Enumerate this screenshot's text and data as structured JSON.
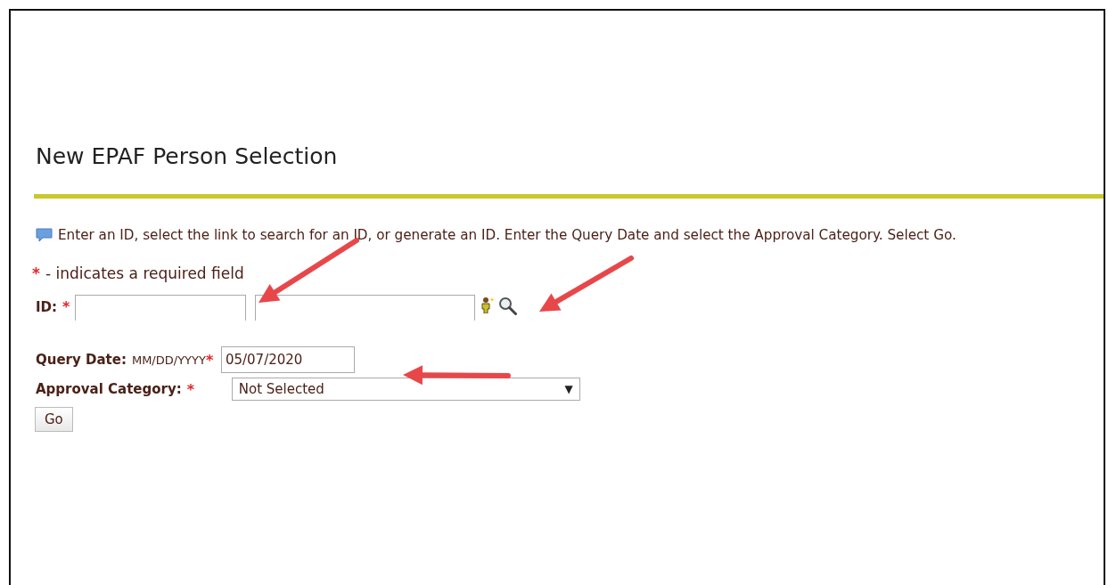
{
  "page": {
    "title": "New EPAF Person Selection",
    "instruction": "Enter an ID, select the link to search for an ID, or generate an ID. Enter the Query Date and select the Approval Category. Select Go.",
    "required_note": {
      "mark": "*",
      "text": "- indicates a required field"
    },
    "id_field": {
      "label": "ID:",
      "required_mark": "*"
    },
    "query_date": {
      "label": "Query Date:",
      "format_hint": "MM/DD/YYYY",
      "required_mark": "*",
      "value": "05/07/2020"
    },
    "approval_category": {
      "label": "Approval Category:",
      "required_mark": "*",
      "value": "Not Selected",
      "caret": "▼"
    },
    "go_button": "Go"
  },
  "annotations": [
    {
      "kind": "arrow"
    },
    {
      "kind": "arrow"
    },
    {
      "kind": "arrow"
    }
  ]
}
